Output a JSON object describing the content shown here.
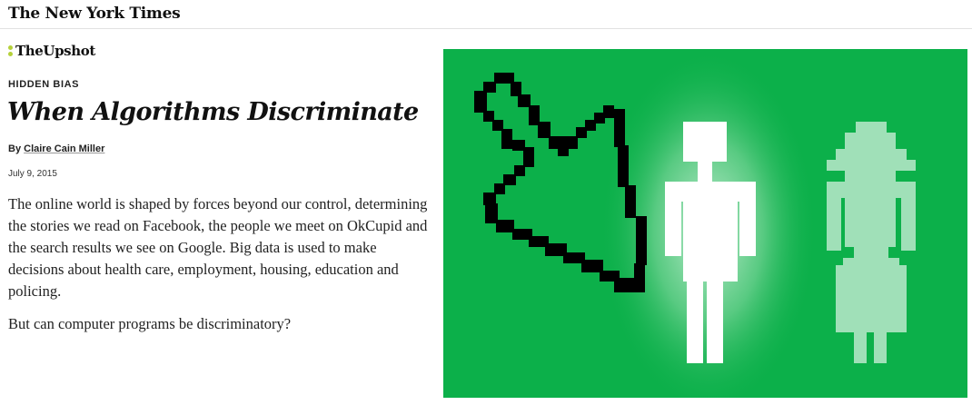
{
  "masthead": {
    "logo_text": "The New York Times"
  },
  "section": {
    "name": "TheUpshot"
  },
  "article": {
    "kicker": "HIDDEN BIAS",
    "headline": "When Algorithms Discriminate",
    "byline_prefix": "By",
    "author": "Claire Cain Miller",
    "date": "July 9, 2015",
    "summary": "The online world is shaped by forces beyond our control, determining the stories we read on Facebook, the people we meet on OkCupid and the search results we see on Google. Big data is used to make decisions about health care, employment, housing, education and policing.",
    "question": "But can computer programs be discriminatory?"
  },
  "illustration": {
    "background_color": "#0cb04a",
    "cursor_color": "#000000",
    "male_figure_color": "#ffffff",
    "female_figure_color": "#a0e0b8",
    "elements": [
      "pixel-cursor-icon",
      "male-figure-icon",
      "female-figure-icon"
    ]
  }
}
